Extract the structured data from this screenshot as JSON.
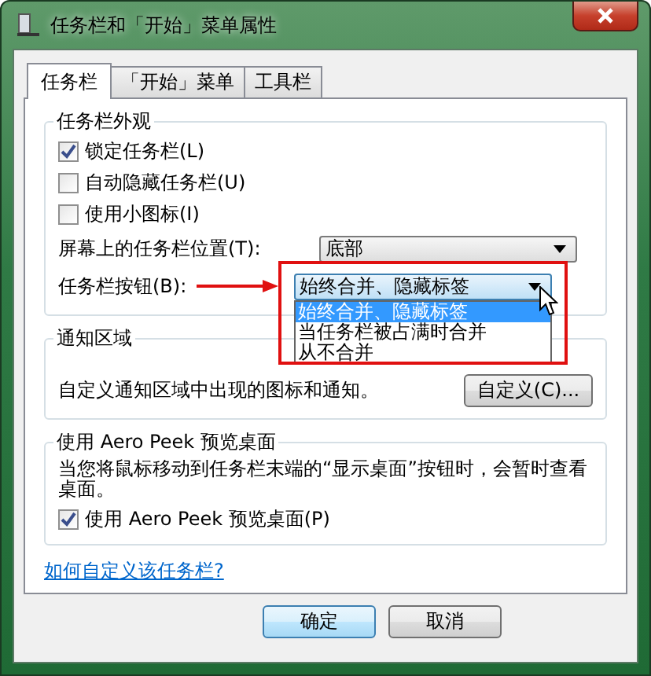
{
  "window": {
    "title": "任务栏和「开始」菜单属性"
  },
  "tabs": [
    {
      "label": "任务栏",
      "selected": true
    },
    {
      "label": "「开始」菜单",
      "selected": false
    },
    {
      "label": "工具栏",
      "selected": false
    }
  ],
  "appearance": {
    "title": "任务栏外观",
    "checkboxes": [
      {
        "label": "锁定任务栏(L)",
        "checked": true
      },
      {
        "label": "自动隐藏任务栏(U)",
        "checked": false
      },
      {
        "label": "使用小图标(I)",
        "checked": false
      }
    ],
    "position": {
      "label": "屏幕上的任务栏位置(T):",
      "value": "底部"
    },
    "taskbar_buttons": {
      "label": "任务栏按钮(B):",
      "value": "始终合并、隐藏标签",
      "expanded": true,
      "options": [
        {
          "label": "始终合并、隐藏标签",
          "selected": true
        },
        {
          "label": "当任务栏被占满时合并",
          "selected": false
        },
        {
          "label": "从不合并",
          "selected": false
        }
      ]
    }
  },
  "notification": {
    "title": "通知区域",
    "text": "自定义通知区域中出现的图标和通知。",
    "button": "自定义(C)..."
  },
  "peek": {
    "title": "使用 Aero Peek 预览桌面",
    "text": "当您将鼠标移动到任务栏末端的“显示桌面”按钮时，会暂时查看桌面。",
    "checkbox": {
      "label": "使用 Aero Peek 预览桌面(P)",
      "checked": true
    }
  },
  "help_link": "如何自定义该任务栏?",
  "buttons": [
    {
      "label": "确定",
      "default": true
    },
    {
      "label": "取消",
      "default": false
    }
  ]
}
